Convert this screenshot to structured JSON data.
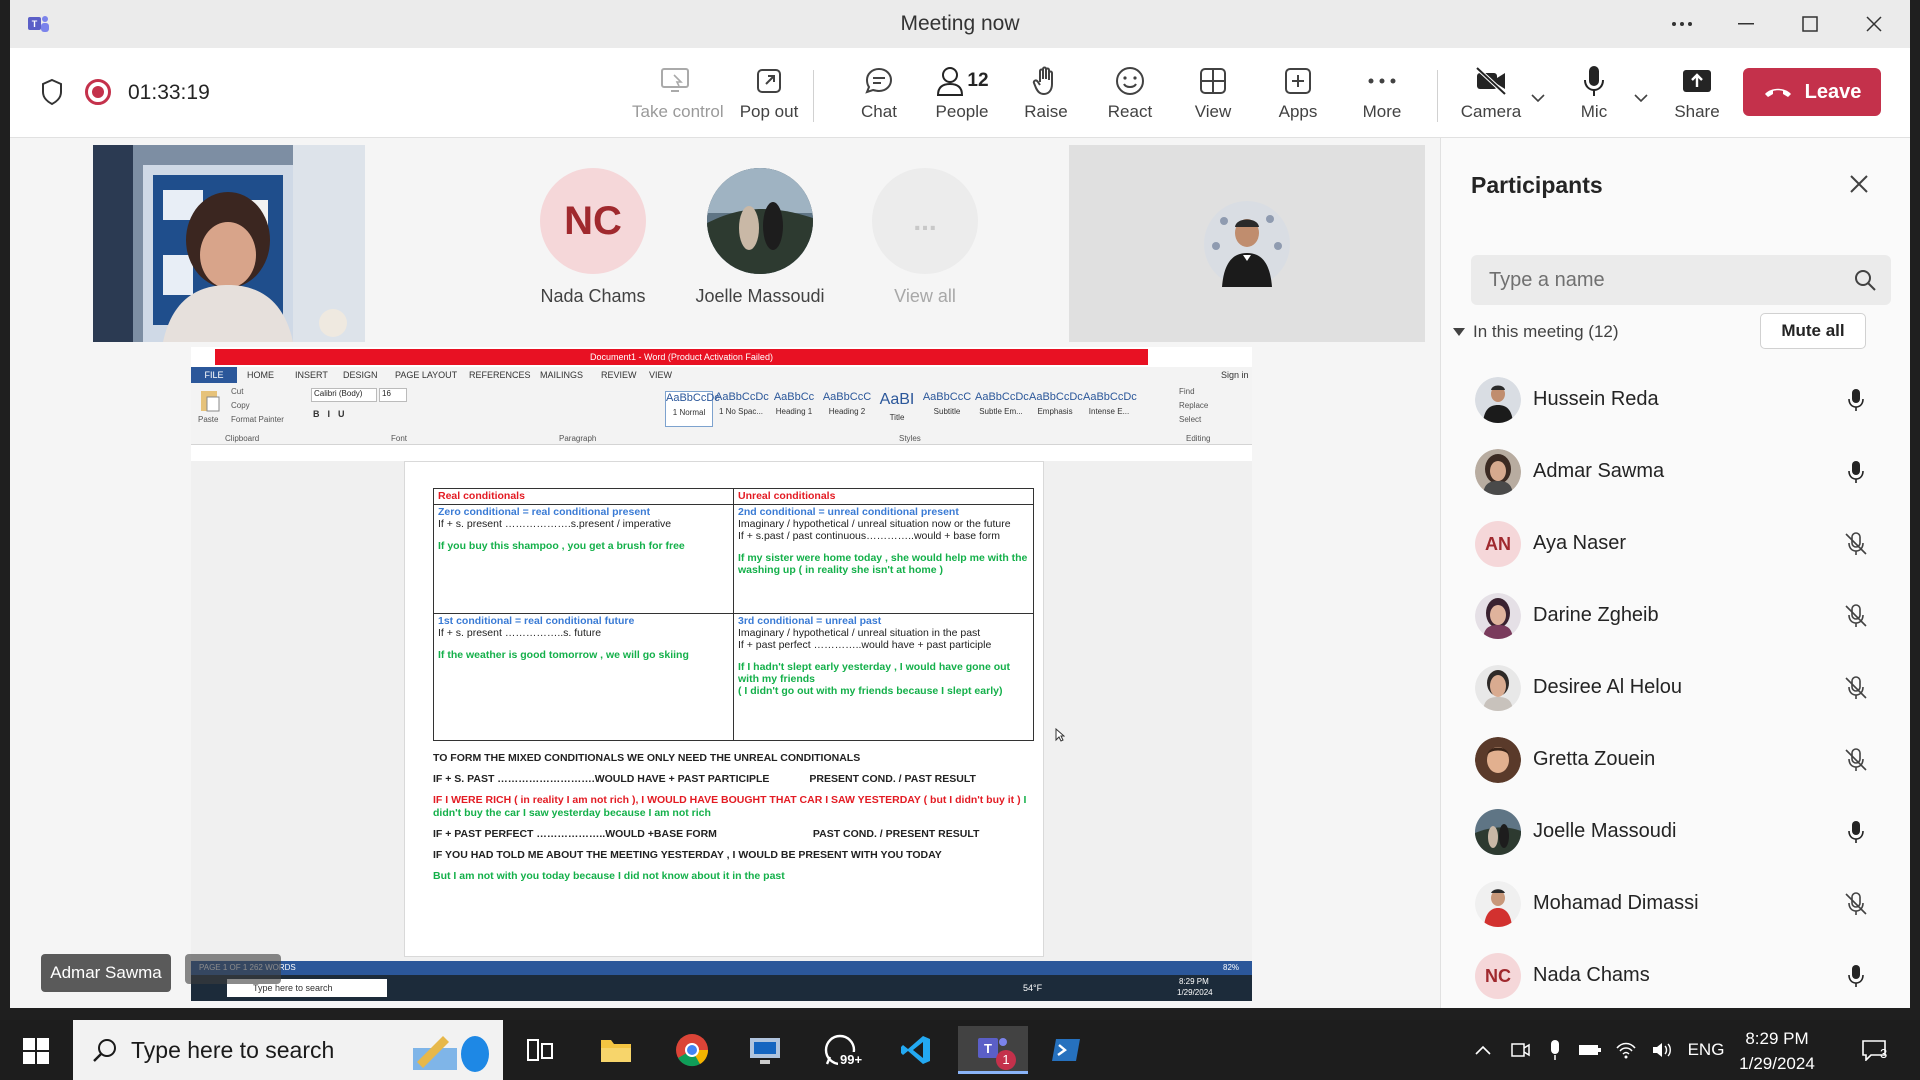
{
  "window": {
    "title": "Meeting now",
    "controls": [
      "more-options",
      "minimize",
      "maximize",
      "close"
    ]
  },
  "toolbar": {
    "timer": "01:33:19",
    "buttons": {
      "take_control": "Take control",
      "pop_out": "Pop out",
      "chat": "Chat",
      "people": "People",
      "people_count": "12",
      "raise": "Raise",
      "react": "React",
      "view": "View",
      "apps": "Apps",
      "more": "More",
      "camera": "Camera",
      "mic": "Mic",
      "share": "Share"
    },
    "leave_label": "Leave",
    "colors": {
      "leave": "#c4314b",
      "active_tab_underline": "#5b5fc7",
      "record": "#c4314b"
    }
  },
  "stage": {
    "tiles": [
      {
        "initials": "NC",
        "name": "Nada Chams"
      },
      {
        "initials": "",
        "name": "Joelle Massoudi"
      },
      {
        "initials": "...",
        "name": "View all"
      }
    ],
    "speaker_label": "Admar Sawma"
  },
  "shared_screen": {
    "word_title": "Document1 - Word (Product Activation Failed)",
    "tabs": [
      "FILE",
      "HOME",
      "INSERT",
      "DESIGN",
      "PAGE LAYOUT",
      "REFERENCES",
      "MAILINGS",
      "REVIEW",
      "VIEW"
    ],
    "sign_in": "Sign in",
    "clipboard": {
      "paste": "Paste",
      "cut": "Cut",
      "copy": "Copy",
      "format_painter": "Format Painter",
      "group": "Clipboard"
    },
    "font": {
      "name": "Calibri (Body)",
      "size": "16",
      "group": "Font"
    },
    "paragraph_group": "Paragraph",
    "styles": [
      {
        "sample": "AaBbCcDc",
        "name": "1 Normal"
      },
      {
        "sample": "AaBbCcDc",
        "name": "1 No Spac..."
      },
      {
        "sample": "AaBbCc",
        "name": "Heading 1"
      },
      {
        "sample": "AaBbCcC",
        "name": "Heading 2"
      },
      {
        "sample": "AaBI",
        "name": "Title"
      },
      {
        "sample": "AaBbCcC",
        "name": "Subtitle"
      },
      {
        "sample": "AaBbCcDc",
        "name": "Subtle Em..."
      },
      {
        "sample": "AaBbCcDc",
        "name": "Emphasis"
      },
      {
        "sample": "AaBbCcDc",
        "name": "Intense E..."
      }
    ],
    "styles_group": "Styles",
    "editing": {
      "find": "Find",
      "replace": "Replace",
      "select": "Select",
      "group": "Editing"
    },
    "table": {
      "real_head": "Real conditionals",
      "unreal_head": "Unreal conditionals",
      "zero_title": "Zero conditional = real conditional present",
      "zero_rule": "If + s. present ……………….s.present / imperative",
      "zero_example": "If you buy this shampoo , you get a brush for free",
      "second_title": "2nd conditional = unreal conditional present",
      "second_desc": "Imaginary / hypothetical / unreal situation now or the future",
      "second_rule": "If + s.past / past continuous…………..would + base form",
      "second_example": "If my sister were home today , she would help me with the washing up ( in reality she isn't at home )",
      "first_title": "1st conditional = real conditional future",
      "first_rule": "If + s. present  ……………..s. future",
      "first_example": "If the weather is good tomorrow , we will go skiing",
      "third_title": "3rd conditional = unreal past",
      "third_desc": "Imaginary / hypothetical / unreal situation in the past",
      "third_rule": "If + past perfect …………..would have + past participle",
      "third_example": "If I hadn't slept  early yesterday , I would have gone out with my friends",
      "third_note": "( I didn't go out with my friends because I slept early)"
    },
    "mixed": {
      "intro": "TO FORM THE MIXED CONDITIONALS WE ONLY NEED THE UNREAL CONDITIONALS",
      "rule1": "IF + S. PAST ……………………….WOULD HAVE + PAST PARTICIPLE",
      "rule1_note": "PRESENT COND. / PAST RESULT",
      "ex1_red": "IF I WERE RICH ( in reality I am not rich ), I WOULD HAVE BOUGHT THAT CAR I SAW YESTERDAY ( but I didn't buy it )",
      "ex1_green": "I didn't buy the car I saw yesterday because I am not rich",
      "rule2": "IF + PAST PERFECT ………………..WOULD +BASE FORM",
      "rule2_note": "PAST COND. / PRESENT RESULT",
      "ex2": "IF YOU HAD TOLD ME ABOUT THE MEETING YESTERDAY , I WOULD BE PRESENT WITH YOU TODAY",
      "ex2_green": "But I am not with you today because I did not know about it in the past"
    },
    "status": "PAGE 1 OF 1    262 WORDS",
    "zoom": "82%",
    "taskbar_search": "Type here to search",
    "weather": "54°F",
    "clock_time": "8:29 PM",
    "clock_date": "1/29/2024"
  },
  "panel": {
    "title": "Participants",
    "search_placeholder": "Type a name",
    "section": "In this meeting (12)",
    "mute_all": "Mute all",
    "participants": [
      {
        "name": "Hussein Reda",
        "initials": "",
        "mic": "on"
      },
      {
        "name": "Admar Sawma",
        "initials": "",
        "mic": "on"
      },
      {
        "name": "Aya Naser",
        "initials": "AN",
        "mic": "muted"
      },
      {
        "name": "Darine Zgheib",
        "initials": "",
        "mic": "muted"
      },
      {
        "name": "Desiree Al Helou",
        "initials": "",
        "mic": "muted"
      },
      {
        "name": "Gretta Zouein",
        "initials": "",
        "mic": "muted"
      },
      {
        "name": "Joelle Massoudi",
        "initials": "",
        "mic": "on"
      },
      {
        "name": "Mohamad Dimassi",
        "initials": "",
        "mic": "muted"
      },
      {
        "name": "Nada Chams",
        "initials": "NC",
        "mic": "on"
      }
    ]
  },
  "taskbar": {
    "search": "Type here to search",
    "whatsapp_badge": "99+",
    "teams_badge": "1",
    "language": "ENG",
    "time": "8:29 PM",
    "date": "1/29/2024",
    "notifications": "3"
  }
}
